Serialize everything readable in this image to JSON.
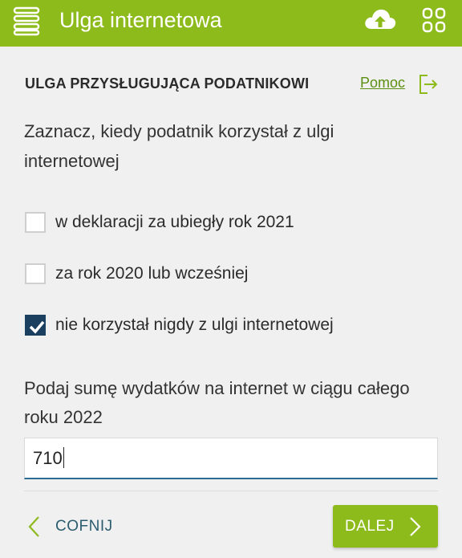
{
  "header": {
    "title": "Ulga internetowa",
    "background": "#8dbb1c",
    "icons": [
      "menu-icon",
      "cloud-upload-icon",
      "grid-icon"
    ]
  },
  "section": {
    "title": "ULGA PRZYSŁUGUJĄCA PODATNIKOWI",
    "help_label": "Pomoc"
  },
  "question": {
    "prompt": "Zaznacz, kiedy podatnik korzystał z ulgi internetowej",
    "options": [
      {
        "label": "w deklaracji za ubiegły rok 2021",
        "checked": false
      },
      {
        "label": "za rok 2020 lub wcześniej",
        "checked": false
      },
      {
        "label": "nie korzystał nigdy z ulgi internetowej",
        "checked": true
      }
    ]
  },
  "amount": {
    "label": "Podaj sumę wydatków na internet w ciągu całego roku 2022",
    "value": "710"
  },
  "footer": {
    "back_label": "COFNIJ",
    "next_label": "DALEJ"
  },
  "colors": {
    "accent": "#8dbb1c",
    "checkbox_checked": "#1b3f5e",
    "link": "#5c8f12"
  }
}
